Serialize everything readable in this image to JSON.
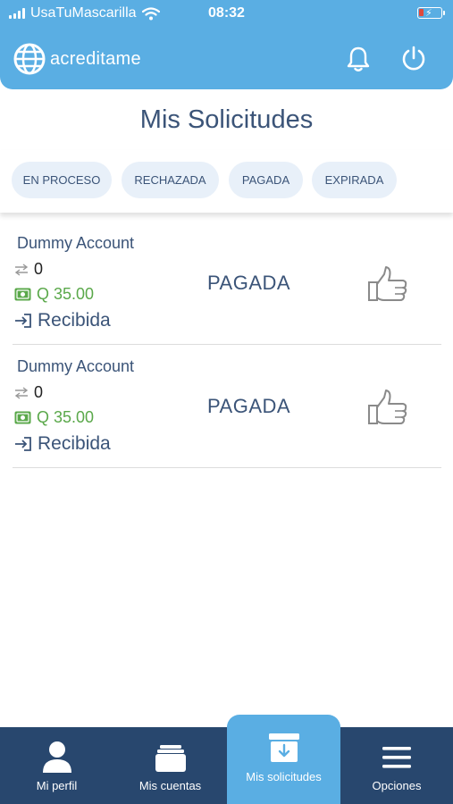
{
  "status_bar": {
    "carrier": "UsaTuMascarilla",
    "time": "08:32"
  },
  "header": {
    "brand": "acreditame"
  },
  "page": {
    "title": "Mis Solicitudes"
  },
  "tabs": [
    {
      "label": "EN PROCESO"
    },
    {
      "label": "RECHAZADA"
    },
    {
      "label": "PAGADA"
    },
    {
      "label": "EXPIRADA"
    }
  ],
  "requests": [
    {
      "account": "Dummy Account",
      "transfers": "0",
      "amount": "Q 35.00",
      "status": "Recibida",
      "state": "PAGADA"
    },
    {
      "account": "Dummy Account",
      "transfers": "0",
      "amount": "Q 35.00",
      "status": "Recibida",
      "state": "PAGADA"
    }
  ],
  "bottom_nav": [
    {
      "label": "Mi perfil",
      "icon": "user-icon"
    },
    {
      "label": "Mis cuentas",
      "icon": "wallet-icon"
    },
    {
      "label": "Mis solicitudes",
      "icon": "archive-download-icon",
      "active": true
    },
    {
      "label": "Opciones",
      "icon": "menu-icon"
    }
  ],
  "colors": {
    "header": "#5aaee3",
    "nav": "#28476e",
    "text": "#3b5478",
    "amount": "#5aa84a",
    "tab_bg": "#e8f0f9"
  }
}
